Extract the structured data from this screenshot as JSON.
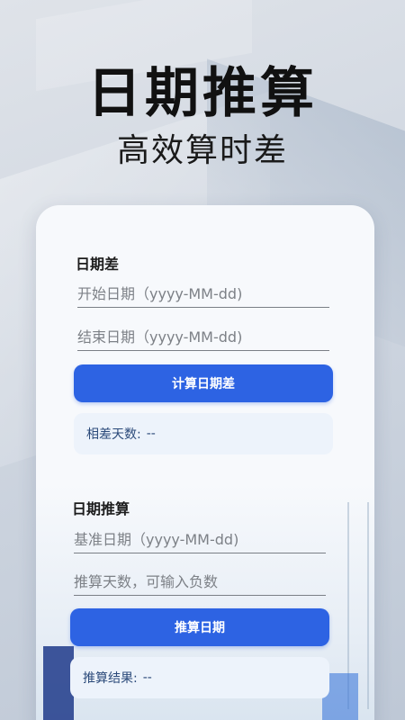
{
  "hero": {
    "title": "日期推算",
    "subtitle": "高效算时差"
  },
  "date_diff": {
    "title": "日期差",
    "start_placeholder": "开始日期（yyyy-MM-dd)",
    "end_placeholder": "结束日期（yyyy-MM-dd)",
    "button_label": "计算日期差",
    "result_label": "相差天数:",
    "result_value": "--"
  },
  "date_calc": {
    "title": "日期推算",
    "base_placeholder": "基准日期（yyyy-MM-dd)",
    "days_placeholder": "推算天数，可输入负数",
    "button_label": "推算日期",
    "result_label": "推算结果:",
    "result_value": "--"
  },
  "colors": {
    "accent": "#2d63e3",
    "result_bg": "#edf3fb"
  }
}
